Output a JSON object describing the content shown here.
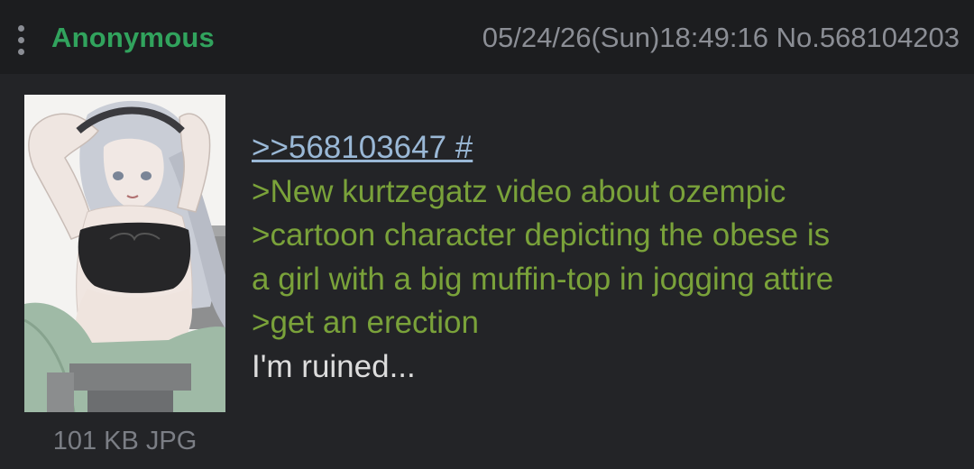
{
  "header": {
    "name": "Anonymous",
    "datetime": "05/24/26(Sun)18:49:16",
    "post_number": "No.568104203"
  },
  "post": {
    "file_info": "101 KB JPG",
    "quote_link": ">>568103647 #",
    "lines": [
      {
        "text": ">New kurtzegatz video about ozempic",
        "style": "greentext"
      },
      {
        "text": ">cartoon character depicting the obese is",
        "style": "greentext"
      },
      {
        "text": "a girl with a big muffin-top in jogging attire",
        "style": "greentext"
      },
      {
        "text": ">get an erection",
        "style": "greentext"
      },
      {
        "text": "I'm ruined...",
        "style": "plain"
      }
    ]
  },
  "colors": {
    "name": "#31a35d",
    "greentext": "#7aa23a",
    "quote_link": "#9ab8d6",
    "background": "#232427",
    "header": "#1c1d1f"
  }
}
